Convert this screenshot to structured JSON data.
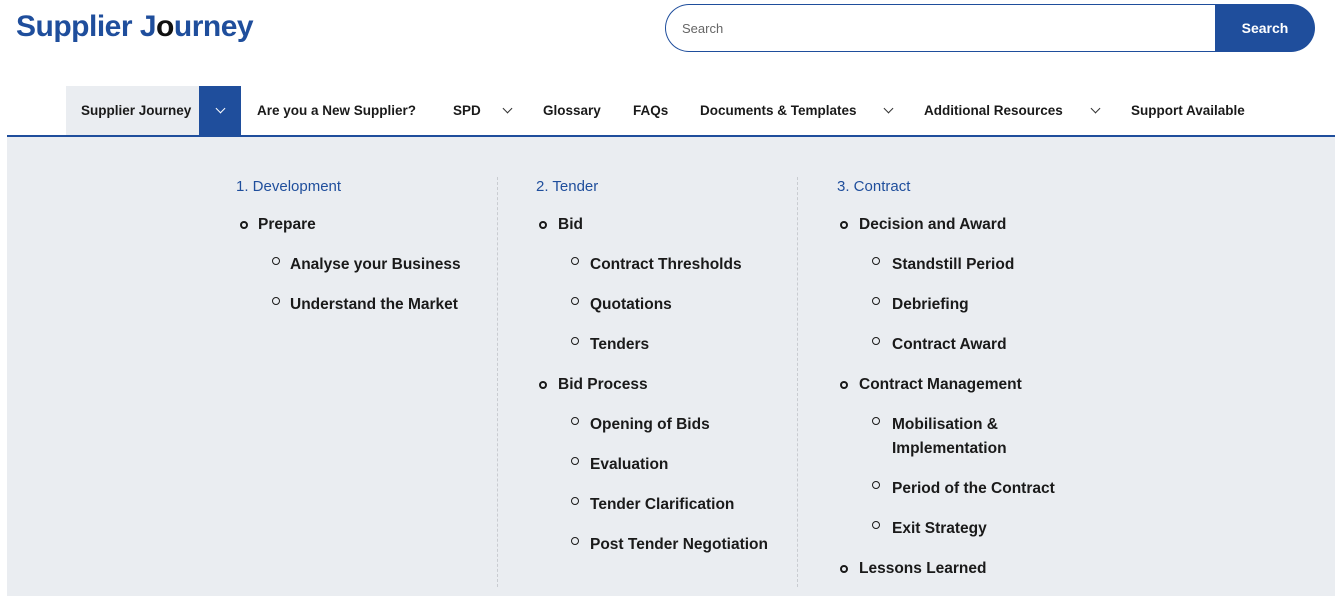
{
  "brand": {
    "part1": "Supplier J",
    "part2": "o",
    "part3": "urney"
  },
  "search": {
    "placeholder": "Search",
    "value": "",
    "button_label": "Search"
  },
  "nav": {
    "items": [
      {
        "label": "Supplier Journey"
      },
      {
        "label": "Are you a New Supplier?"
      },
      {
        "label": "SPD"
      },
      {
        "label": "Glossary"
      },
      {
        "label": "FAQs"
      },
      {
        "label": "Documents & Templates"
      },
      {
        "label": "Additional Resources"
      },
      {
        "label": "Support Available"
      }
    ]
  },
  "menu": {
    "columns": [
      {
        "title": "1. Development",
        "items": [
          {
            "label": "Prepare",
            "children": [
              "Analyse your Business",
              "Understand the Market"
            ]
          }
        ]
      },
      {
        "title": "2. Tender",
        "items": [
          {
            "label": "Bid",
            "children": [
              "Contract Thresholds",
              "Quotations",
              "Tenders"
            ]
          },
          {
            "label": "Bid Process",
            "children": [
              "Opening of Bids",
              "Evaluation",
              "Tender Clarification",
              "Post Tender Negotiation"
            ]
          }
        ]
      },
      {
        "title": "3. Contract",
        "items": [
          {
            "label": "Decision and Award",
            "children": [
              "Standstill Period",
              "Debriefing",
              "Contract Award"
            ]
          },
          {
            "label": "Contract Management",
            "children": [
              "Mobilisation & Implementation",
              "Period of the Contract",
              "Exit Strategy"
            ]
          },
          {
            "label": "Lessons Learned",
            "children": []
          }
        ]
      }
    ]
  },
  "colors": {
    "brand": "#1f4e9c",
    "menu_bg": "#eaedf1",
    "text": "#1a1a1a"
  }
}
